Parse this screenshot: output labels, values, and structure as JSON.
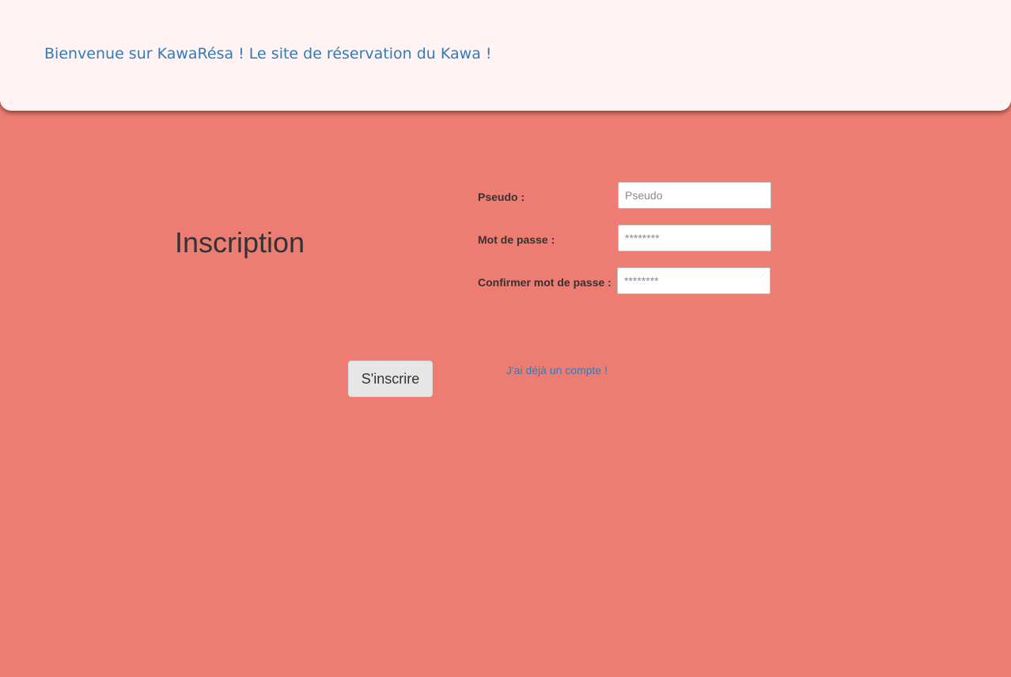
{
  "header": {
    "title": "Bienvenue sur KawaRésa ! Le site de réservation du Kawa !"
  },
  "main": {
    "heading": "Inscription"
  },
  "form": {
    "pseudo": {
      "label": "Pseudo :",
      "placeholder": "Pseudo",
      "value": ""
    },
    "password": {
      "label": "Mot de passe :",
      "placeholder": "********",
      "value": ""
    },
    "confirm_password": {
      "label": "Confirmer mot de passe :",
      "placeholder": "********",
      "value": ""
    },
    "submit_label": "S'inscrire",
    "login_link": "J'ai déjà un compte !"
  },
  "colors": {
    "background": "#ed7d72",
    "header_background": "#fff3f3",
    "link": "#337ab7",
    "text": "#333333",
    "button": "#e6e6e6"
  }
}
